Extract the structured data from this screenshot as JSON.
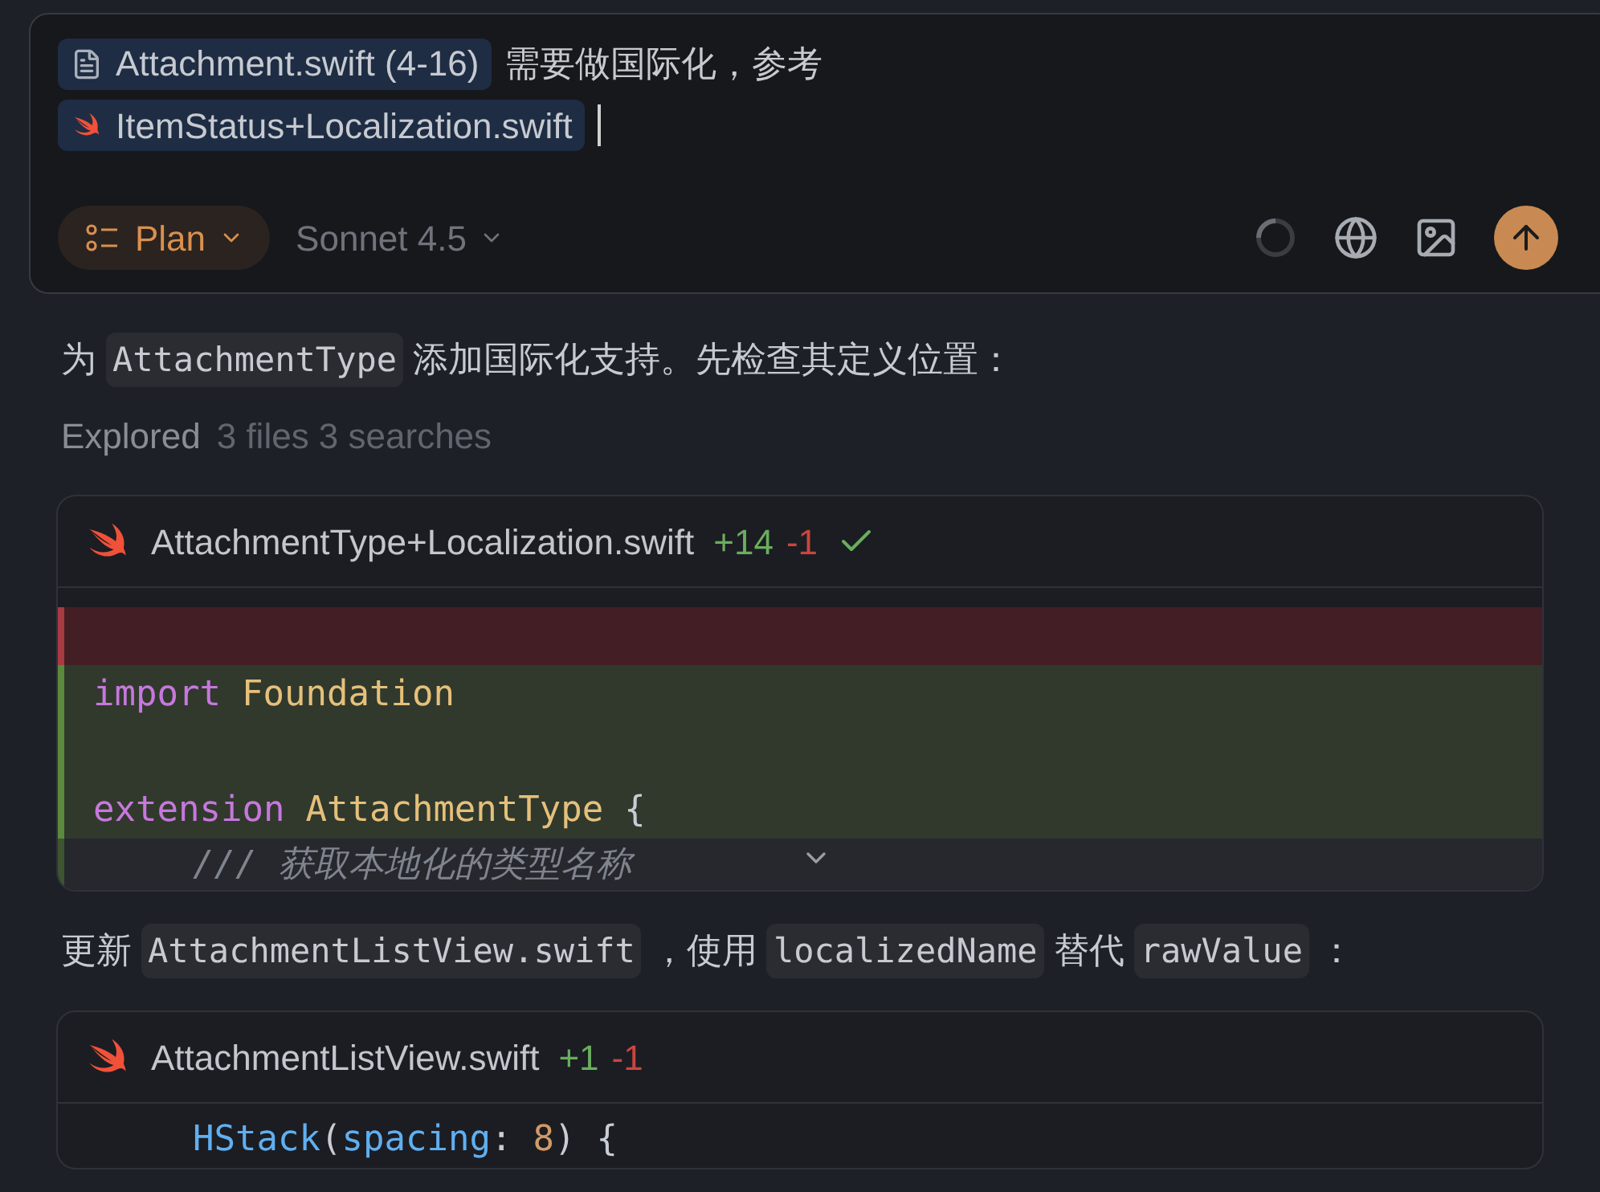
{
  "composer": {
    "chips": [
      {
        "kind": "file",
        "label": "Attachment.swift (4-16)"
      },
      {
        "kind": "swift",
        "label": "ItemStatus+Localization.swift"
      }
    ],
    "text": "需要做国际化，参考",
    "mode": {
      "label": "Plan"
    },
    "model": {
      "label": "Sonnet 4.5"
    }
  },
  "messages": [
    {
      "kind": "text",
      "segments": [
        {
          "kind": "text",
          "text": "为"
        },
        {
          "kind": "code",
          "text": "AttachmentType"
        },
        {
          "kind": "text",
          "text": "添加国际化支持。先检查其定义位置："
        }
      ]
    },
    {
      "kind": "explored",
      "label": "Explored",
      "detail": "3 files 3 searches"
    },
    {
      "kind": "diff",
      "file": "AttachmentType+Localization.swift",
      "added": "+14",
      "removed": "-1",
      "done": true,
      "collapsed": true,
      "lines": [
        {
          "kind": "removed"
        },
        {
          "kind": "added",
          "tokens": [
            {
              "kind": "keyword",
              "text": "import"
            },
            {
              "kind": "type",
              "text": "Foundation",
              "space": true
            }
          ]
        },
        {
          "kind": "added"
        },
        {
          "kind": "added",
          "tokens": [
            {
              "kind": "keyword",
              "text": "extension"
            },
            {
              "kind": "type",
              "text": "AttachmentType",
              "space": true
            },
            {
              "kind": "plain",
              "text": "{",
              "space": true
            }
          ]
        },
        {
          "kind": "added",
          "indented": true,
          "tokens": [
            {
              "kind": "comment",
              "text": "/// 获取本地化的类型名称"
            }
          ]
        }
      ]
    },
    {
      "kind": "text",
      "segments": [
        {
          "kind": "text",
          "text": "更新"
        },
        {
          "kind": "code",
          "text": "AttachmentListView.swift"
        },
        {
          "kind": "text",
          "text": "，使用"
        },
        {
          "kind": "code",
          "text": "localizedName"
        },
        {
          "kind": "text",
          "text": "替代"
        },
        {
          "kind": "code",
          "text": "rawValue"
        },
        {
          "kind": "text",
          "text": "："
        }
      ]
    },
    {
      "kind": "diff",
      "file": "AttachmentListView.swift",
      "added": "+1",
      "removed": "-1",
      "done": false,
      "collapsed": false,
      "lines": [
        {
          "kind": "context",
          "indented": true,
          "tokens": [
            {
              "kind": "func",
              "text": "HStack"
            },
            {
              "kind": "plain",
              "text": "("
            },
            {
              "kind": "param",
              "text": "spacing"
            },
            {
              "kind": "plain",
              "text": ":"
            },
            {
              "kind": "number",
              "text": "8",
              "space": true
            },
            {
              "kind": "plain",
              "text": ")"
            },
            {
              "kind": "plain",
              "text": "{",
              "space": true
            }
          ]
        }
      ]
    }
  ]
}
